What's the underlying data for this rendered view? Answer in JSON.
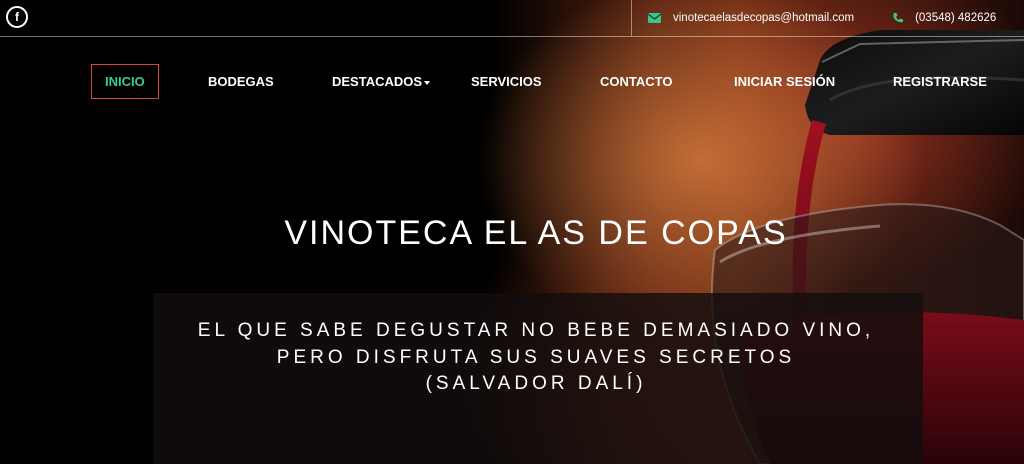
{
  "topbar": {
    "facebook_icon": "facebook-icon",
    "email": "vinotecaelasdecopas@hotmail.com",
    "phone": "(03548) 482626",
    "mail_icon": "envelope-icon",
    "phone_icon": "phone-icon",
    "icon_color": "#3bc48e"
  },
  "nav": {
    "items": [
      {
        "label": "INICIO",
        "active": true
      },
      {
        "label": "BODEGAS"
      },
      {
        "label": "DESTACADOS",
        "dropdown": true
      },
      {
        "label": "SERVICIOS"
      },
      {
        "label": "CONTACTO"
      },
      {
        "label": "INICIAR SESIÓN"
      },
      {
        "label": "REGISTRARSE"
      }
    ],
    "active_color": "#38c8a0",
    "active_border": "#d9473b"
  },
  "hero": {
    "title": "VINOTECA EL AS DE COPAS",
    "quote_lines": [
      "EL QUE SABE DEGUSTAR NO BEBE DEMASIADO VINO,",
      "PERO DISFRUTA SUS SUAVES SECRETOS",
      "(SALVADOR DALÍ)"
    ]
  }
}
